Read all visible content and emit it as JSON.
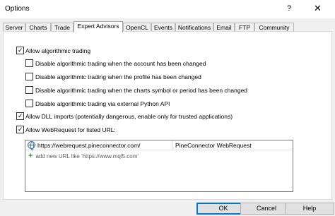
{
  "window": {
    "title": "Options",
    "help_glyph": "?",
    "close_glyph": "✕"
  },
  "tabs": [
    {
      "label": "Server"
    },
    {
      "label": "Charts"
    },
    {
      "label": "Trade"
    },
    {
      "label": "Expert Advisors"
    },
    {
      "label": "OpenCL"
    },
    {
      "label": "Events"
    },
    {
      "label": "Notifications"
    },
    {
      "label": "Email"
    },
    {
      "label": "FTP"
    },
    {
      "label": "Community"
    }
  ],
  "active_tab": "Expert Advisors",
  "options": {
    "allow_algo": {
      "label": "Allow algorithmic trading",
      "checked": true
    },
    "disable_account": {
      "label": "Disable algorithmic trading when the account has been changed",
      "checked": false
    },
    "disable_profile": {
      "label": "Disable algorithmic trading when the profile has been changed",
      "checked": false
    },
    "disable_symbol": {
      "label": "Disable algorithmic trading when the charts symbol or period has been changed",
      "checked": false
    },
    "disable_python": {
      "label": "Disable algorithmic trading via external Python API",
      "checked": false
    },
    "allow_dll": {
      "label": "Allow DLL imports (potentially dangerous, enable only for trusted applications)",
      "checked": true
    },
    "allow_webrequest": {
      "label": "Allow WebRequest for listed URL:",
      "checked": true
    }
  },
  "check_glyph": "✓",
  "url_list": {
    "entries": [
      {
        "url": "https://webrequest.pineconnector.com/",
        "name": "PineConnector WebRequest"
      }
    ],
    "add_placeholder": "add new URL like 'https://www.mql5.com'",
    "add_glyph": "+"
  },
  "buttons": {
    "ok": "OK",
    "cancel": "Cancel",
    "help": "Help"
  }
}
